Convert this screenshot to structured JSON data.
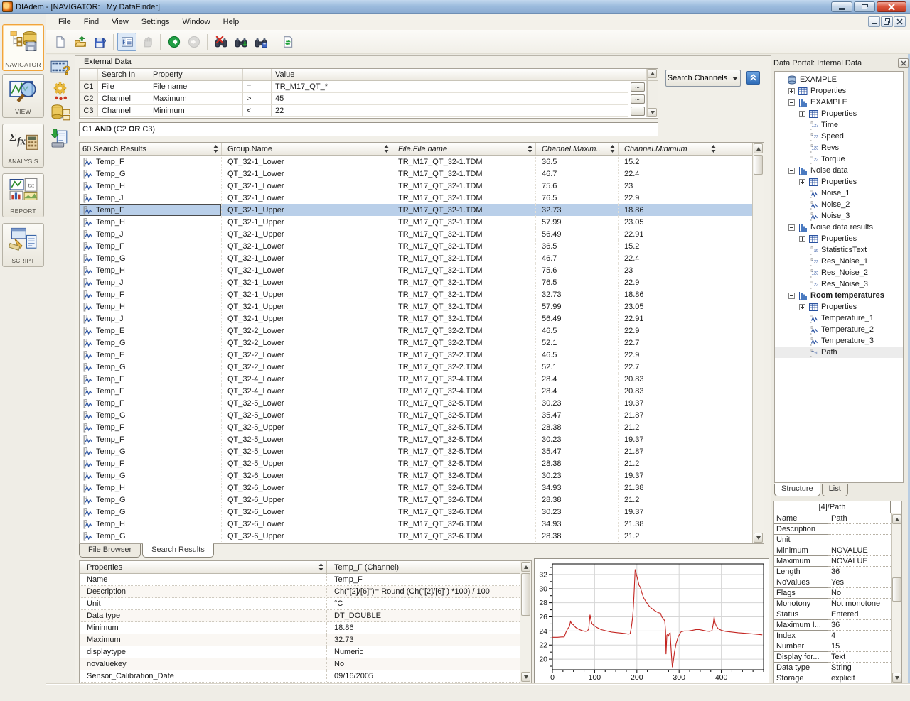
{
  "window": {
    "title": "DIAdem - [NAVIGATOR:   My DataFinder]"
  },
  "menu": {
    "items": [
      "File",
      "Find",
      "View",
      "Settings",
      "Window",
      "Help"
    ]
  },
  "toolbar": {
    "icons": [
      {
        "name": "new-document-icon"
      },
      {
        "name": "open-folder-icon"
      },
      {
        "name": "save-help-icon"
      },
      {
        "name": "sep"
      },
      {
        "name": "tree-panel-toggle-icon",
        "pressed": true
      },
      {
        "name": "pan-hand-icon",
        "disabled": true
      },
      {
        "name": "sep"
      },
      {
        "name": "navigate-back-icon"
      },
      {
        "name": "navigate-forward-icon",
        "disabled": true
      },
      {
        "name": "sep"
      },
      {
        "name": "clear-search-icon"
      },
      {
        "name": "load-search-icon"
      },
      {
        "name": "save-search-icon"
      },
      {
        "name": "sep"
      },
      {
        "name": "refresh-icon"
      }
    ]
  },
  "sidebar": {
    "modules": [
      {
        "label": "NAVIGATOR",
        "active": true
      },
      {
        "label": "VIEW",
        "active": false
      },
      {
        "label": "ANALYSIS",
        "active": false
      },
      {
        "label": "REPORT",
        "active": false
      },
      {
        "label": "SCRIPT",
        "active": false
      }
    ],
    "strip_icons": [
      "film-help-icon",
      "gear-settings-icon",
      "datastore-panel-icon",
      "script-import-icon"
    ]
  },
  "search_panel": {
    "title": "External Data",
    "columns": {
      "search_in": "Search In",
      "property": "Property",
      "value": "Value"
    },
    "conditions": [
      {
        "id": "C1",
        "search_in": "File",
        "property": "File name",
        "operator": "=",
        "value": "TR_M17_QT_*"
      },
      {
        "id": "C2",
        "search_in": "Channel",
        "property": "Maximum",
        "operator": ">",
        "value": "45"
      },
      {
        "id": "C3",
        "search_in": "Channel",
        "property": "Minimum",
        "operator": "<",
        "value": "22"
      }
    ],
    "ellipsis_label": "...",
    "logic_tokens": [
      {
        "text": "C1 ",
        "bold": false
      },
      {
        "text": "AND",
        "bold": true
      },
      {
        "text": " (C2 ",
        "bold": false
      },
      {
        "text": "OR",
        "bold": true
      },
      {
        "text": " C3)",
        "bold": false
      }
    ],
    "search_button": "Search Channels"
  },
  "results": {
    "columns": [
      {
        "label": "60 Search Results",
        "italic": false
      },
      {
        "label": "Group.Name",
        "italic": false
      },
      {
        "label": "File.File name",
        "italic": true
      },
      {
        "label": "Channel.Maxim..",
        "italic": true
      },
      {
        "label": "Channel.Minimum",
        "italic": true
      }
    ],
    "selected_index": 4,
    "rows": [
      [
        "Temp_F",
        "QT_32-1_Lower",
        "TR_M17_QT_32-1.TDM",
        "36.5",
        "15.2"
      ],
      [
        "Temp_G",
        "QT_32-1_Lower",
        "TR_M17_QT_32-1.TDM",
        "46.7",
        "22.4"
      ],
      [
        "Temp_H",
        "QT_32-1_Lower",
        "TR_M17_QT_32-1.TDM",
        "75.6",
        "23"
      ],
      [
        "Temp_J",
        "QT_32-1_Lower",
        "TR_M17_QT_32-1.TDM",
        "76.5",
        "22.9"
      ],
      [
        "Temp_F",
        "QT_32-1_Upper",
        "TR_M17_QT_32-1.TDM",
        "32.73",
        "18.86"
      ],
      [
        "Temp_H",
        "QT_32-1_Upper",
        "TR_M17_QT_32-1.TDM",
        "57.99",
        "23.05"
      ],
      [
        "Temp_J",
        "QT_32-1_Upper",
        "TR_M17_QT_32-1.TDM",
        "56.49",
        "22.91"
      ],
      [
        "Temp_F",
        "QT_32-1_Lower",
        "TR_M17_QT_32-1.TDM",
        "36.5",
        "15.2"
      ],
      [
        "Temp_G",
        "QT_32-1_Lower",
        "TR_M17_QT_32-1.TDM",
        "46.7",
        "22.4"
      ],
      [
        "Temp_H",
        "QT_32-1_Lower",
        "TR_M17_QT_32-1.TDM",
        "75.6",
        "23"
      ],
      [
        "Temp_J",
        "QT_32-1_Lower",
        "TR_M17_QT_32-1.TDM",
        "76.5",
        "22.9"
      ],
      [
        "Temp_F",
        "QT_32-1_Upper",
        "TR_M17_QT_32-1.TDM",
        "32.73",
        "18.86"
      ],
      [
        "Temp_H",
        "QT_32-1_Upper",
        "TR_M17_QT_32-1.TDM",
        "57.99",
        "23.05"
      ],
      [
        "Temp_J",
        "QT_32-1_Upper",
        "TR_M17_QT_32-1.TDM",
        "56.49",
        "22.91"
      ],
      [
        "Temp_E",
        "QT_32-2_Lower",
        "TR_M17_QT_32-2.TDM",
        "46.5",
        "22.9"
      ],
      [
        "Temp_G",
        "QT_32-2_Lower",
        "TR_M17_QT_32-2.TDM",
        "52.1",
        "22.7"
      ],
      [
        "Temp_E",
        "QT_32-2_Lower",
        "TR_M17_QT_32-2.TDM",
        "46.5",
        "22.9"
      ],
      [
        "Temp_G",
        "QT_32-2_Lower",
        "TR_M17_QT_32-2.TDM",
        "52.1",
        "22.7"
      ],
      [
        "Temp_F",
        "QT_32-4_Lower",
        "TR_M17_QT_32-4.TDM",
        "28.4",
        "20.83"
      ],
      [
        "Temp_F",
        "QT_32-4_Lower",
        "TR_M17_QT_32-4.TDM",
        "28.4",
        "20.83"
      ],
      [
        "Temp_F",
        "QT_32-5_Lower",
        "TR_M17_QT_32-5.TDM",
        "30.23",
        "19.37"
      ],
      [
        "Temp_G",
        "QT_32-5_Lower",
        "TR_M17_QT_32-5.TDM",
        "35.47",
        "21.87"
      ],
      [
        "Temp_F",
        "QT_32-5_Upper",
        "TR_M17_QT_32-5.TDM",
        "28.38",
        "21.2"
      ],
      [
        "Temp_F",
        "QT_32-5_Lower",
        "TR_M17_QT_32-5.TDM",
        "30.23",
        "19.37"
      ],
      [
        "Temp_G",
        "QT_32-5_Lower",
        "TR_M17_QT_32-5.TDM",
        "35.47",
        "21.87"
      ],
      [
        "Temp_F",
        "QT_32-5_Upper",
        "TR_M17_QT_32-5.TDM",
        "28.38",
        "21.2"
      ],
      [
        "Temp_G",
        "QT_32-6_Lower",
        "TR_M17_QT_32-6.TDM",
        "30.23",
        "19.37"
      ],
      [
        "Temp_H",
        "QT_32-6_Lower",
        "TR_M17_QT_32-6.TDM",
        "34.93",
        "21.38"
      ],
      [
        "Temp_G",
        "QT_32-6_Upper",
        "TR_M17_QT_32-6.TDM",
        "28.38",
        "21.2"
      ],
      [
        "Temp_G",
        "QT_32-6_Lower",
        "TR_M17_QT_32-6.TDM",
        "30.23",
        "19.37"
      ],
      [
        "Temp_H",
        "QT_32-6_Lower",
        "TR_M17_QT_32-6.TDM",
        "34.93",
        "21.38"
      ],
      [
        "Temp_G",
        "QT_32-6_Upper",
        "TR_M17_QT_32-6.TDM",
        "28.38",
        "21.2"
      ]
    ]
  },
  "bottom_tabs": {
    "items": [
      "File Browser",
      "Search Results"
    ],
    "active": 1
  },
  "channel_properties": {
    "header_left": "Properties",
    "header_right": "Temp_F (Channel)",
    "rows": [
      [
        "Name",
        "Temp_F"
      ],
      [
        "Description",
        "Ch(\"[2]/[6]\")= Round (Ch(\"[2]/[6]\") *100) / 100"
      ],
      [
        "Unit",
        "°C"
      ],
      [
        "Data type",
        "DT_DOUBLE"
      ],
      [
        "Minimum",
        "18.86"
      ],
      [
        "Maximum",
        "32.73"
      ],
      [
        "displaytype",
        "Numeric"
      ],
      [
        "novaluekey",
        "No"
      ],
      [
        "Sensor_Calibration_Date",
        "09/16/2005"
      ]
    ]
  },
  "chart_data": {
    "type": "line",
    "title": "",
    "xlabel": "",
    "ylabel": "",
    "xlim": [
      0,
      500
    ],
    "ylim": [
      18.5,
      33.5
    ],
    "xticks": [
      0,
      100,
      200,
      300,
      400
    ],
    "yticks": [
      20,
      22,
      24,
      26,
      28,
      30,
      32
    ],
    "x_minor_step": 25,
    "y_minor_step": 1,
    "grid": true,
    "legend": "none",
    "series": [
      {
        "name": "Temp_F",
        "color": "#c32420",
        "points": [
          [
            0,
            23.1
          ],
          [
            12,
            23.1
          ],
          [
            22,
            23.15
          ],
          [
            28,
            23.15
          ],
          [
            32,
            23.8
          ],
          [
            36,
            24.3
          ],
          [
            40,
            24.6
          ],
          [
            43,
            25.35
          ],
          [
            46,
            25.0
          ],
          [
            50,
            24.85
          ],
          [
            55,
            24.5
          ],
          [
            62,
            24.25
          ],
          [
            70,
            24.05
          ],
          [
            78,
            23.95
          ],
          [
            83,
            24.0
          ],
          [
            86,
            24.3
          ],
          [
            89,
            26.3
          ],
          [
            91,
            25.6
          ],
          [
            94,
            25.0
          ],
          [
            98,
            24.8
          ],
          [
            105,
            24.5
          ],
          [
            115,
            24.2
          ],
          [
            125,
            24.05
          ],
          [
            140,
            23.85
          ],
          [
            155,
            23.75
          ],
          [
            170,
            23.65
          ],
          [
            180,
            23.55
          ],
          [
            184,
            23.6
          ],
          [
            187,
            24.5
          ],
          [
            190,
            26.0
          ],
          [
            192,
            27.5
          ],
          [
            194,
            30.0
          ],
          [
            196,
            32.73
          ],
          [
            199,
            32.0
          ],
          [
            202,
            31.3
          ],
          [
            205,
            30.5
          ],
          [
            208,
            30.2
          ],
          [
            212,
            29.4
          ],
          [
            216,
            28.7
          ],
          [
            221,
            28.2
          ],
          [
            228,
            27.6
          ],
          [
            235,
            27.2
          ],
          [
            243,
            26.85
          ],
          [
            250,
            26.6
          ],
          [
            256,
            26.5
          ],
          [
            259,
            26.0
          ],
          [
            263,
            25.7
          ],
          [
            266,
            25.45
          ],
          [
            268,
            24.0
          ],
          [
            269,
            20.7
          ],
          [
            270,
            22.0
          ],
          [
            271,
            23.4
          ],
          [
            273,
            23.5
          ],
          [
            275,
            23.3
          ],
          [
            277,
            23.65
          ],
          [
            279,
            23.7
          ],
          [
            280,
            22.5
          ],
          [
            282,
            20.5
          ],
          [
            284,
            18.86
          ],
          [
            286,
            19.6
          ],
          [
            289,
            21.0
          ],
          [
            293,
            22.2
          ],
          [
            298,
            23.2
          ],
          [
            304,
            23.85
          ],
          [
            312,
            24.0
          ],
          [
            322,
            24.0
          ],
          [
            332,
            24.1
          ],
          [
            340,
            24.2
          ],
          [
            348,
            24.2
          ],
          [
            356,
            24.1
          ],
          [
            364,
            24.0
          ],
          [
            372,
            23.95
          ],
          [
            378,
            24.05
          ],
          [
            381,
            25.0
          ],
          [
            383,
            26.0
          ],
          [
            385,
            25.2
          ],
          [
            388,
            24.7
          ],
          [
            393,
            24.3
          ],
          [
            400,
            24.1
          ],
          [
            410,
            23.95
          ],
          [
            425,
            23.85
          ],
          [
            440,
            23.75
          ],
          [
            460,
            23.65
          ],
          [
            480,
            23.55
          ],
          [
            497,
            23.45
          ]
        ]
      }
    ]
  },
  "data_portal": {
    "title": "Data Portal: Internal Data",
    "tree": [
      {
        "label": "EXAMPLE",
        "icon": "datastore",
        "depth": 0,
        "expander": ""
      },
      {
        "label": "Properties",
        "icon": "props",
        "depth": 1,
        "expander": "plus"
      },
      {
        "label": "EXAMPLE",
        "icon": "group",
        "depth": 1,
        "expander": "minus"
      },
      {
        "label": "Properties",
        "icon": "props",
        "depth": 2,
        "expander": "plus"
      },
      {
        "label": "Time",
        "icon": "num",
        "depth": 2,
        "expander": ""
      },
      {
        "label": "Speed",
        "icon": "num",
        "depth": 2,
        "expander": ""
      },
      {
        "label": "Revs",
        "icon": "num",
        "depth": 2,
        "expander": ""
      },
      {
        "label": "Torque",
        "icon": "num",
        "depth": 2,
        "expander": ""
      },
      {
        "label": "Noise data",
        "icon": "group",
        "depth": 1,
        "expander": "minus"
      },
      {
        "label": "Properties",
        "icon": "props",
        "depth": 2,
        "expander": "plus"
      },
      {
        "label": "Noise_1",
        "icon": "wave",
        "depth": 2,
        "expander": ""
      },
      {
        "label": "Noise_2",
        "icon": "wave",
        "depth": 2,
        "expander": ""
      },
      {
        "label": "Noise_3",
        "icon": "wave",
        "depth": 2,
        "expander": ""
      },
      {
        "label": "Noise data results",
        "icon": "group",
        "depth": 1,
        "expander": "minus"
      },
      {
        "label": "Properties",
        "icon": "props",
        "depth": 2,
        "expander": "plus"
      },
      {
        "label": "StatisticsText",
        "icon": "txt",
        "depth": 2,
        "expander": ""
      },
      {
        "label": "Res_Noise_1",
        "icon": "num",
        "depth": 2,
        "expander": ""
      },
      {
        "label": "Res_Noise_2",
        "icon": "num",
        "depth": 2,
        "expander": ""
      },
      {
        "label": "Res_Noise_3",
        "icon": "num",
        "depth": 2,
        "expander": ""
      },
      {
        "label": "Room temperatures",
        "icon": "group",
        "depth": 1,
        "expander": "minus",
        "bold": true
      },
      {
        "label": "Properties",
        "icon": "props",
        "depth": 2,
        "expander": "plus"
      },
      {
        "label": "Temperature_1",
        "icon": "wave",
        "depth": 2,
        "expander": ""
      },
      {
        "label": "Temperature_2",
        "icon": "wave",
        "depth": 2,
        "expander": ""
      },
      {
        "label": "Temperature_3",
        "icon": "wave",
        "depth": 2,
        "expander": ""
      },
      {
        "label": "Path",
        "icon": "txt",
        "depth": 2,
        "expander": "",
        "selected": true
      }
    ],
    "tabs": {
      "items": [
        "Structure",
        "List"
      ],
      "active": 0
    },
    "properties": {
      "header": "[4]/Path",
      "rows": [
        [
          "Name",
          "Path"
        ],
        [
          "Description",
          ""
        ],
        [
          "Unit",
          ""
        ],
        [
          "Minimum",
          "NOVALUE"
        ],
        [
          "Maximum",
          "NOVALUE"
        ],
        [
          "Length",
          "36"
        ],
        [
          "NoValues",
          "Yes"
        ],
        [
          "Flags",
          "No"
        ],
        [
          "Monotony",
          "Not monotone"
        ],
        [
          "Status",
          "Entered"
        ],
        [
          "Maximum I...",
          "36"
        ],
        [
          "Index",
          "4"
        ],
        [
          "Number",
          "15"
        ],
        [
          "Display for...",
          "Text"
        ],
        [
          "Data type",
          "String"
        ],
        [
          "Storage",
          "explicit"
        ]
      ]
    }
  }
}
